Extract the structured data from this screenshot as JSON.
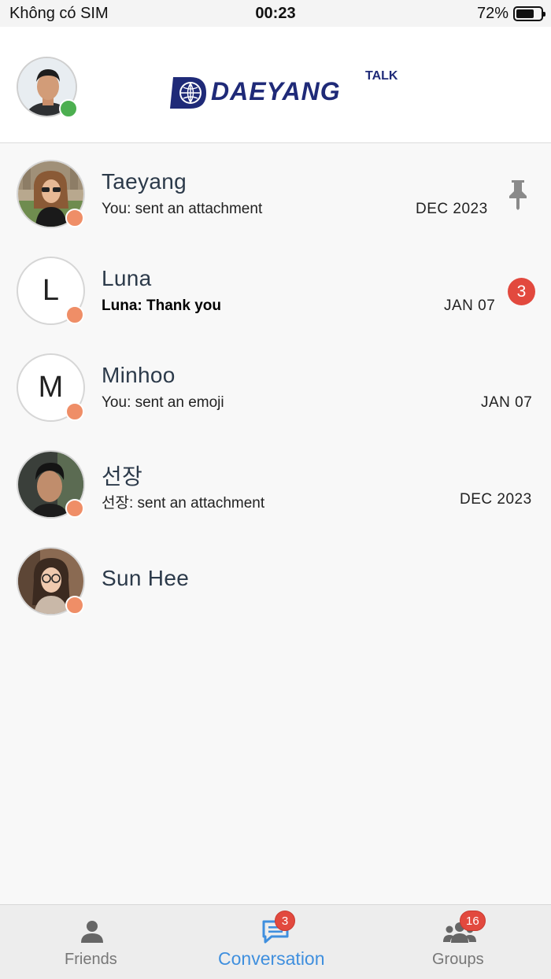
{
  "status_bar": {
    "carrier": "Không có SIM",
    "time": "00:23",
    "battery": "72%",
    "battery_level": 0.72
  },
  "header": {
    "logo_text": "DAEYANG",
    "logo_suffix": "TALK",
    "me_status_color": "#4caf50"
  },
  "conversations": [
    {
      "name": "Taeyang",
      "preview": "You: sent an attachment",
      "date": "DEC 2023",
      "pinned": true,
      "avatar": "photo"
    },
    {
      "name": "Luna",
      "preview": "Luna: Thank you",
      "date": "JAN 07",
      "unread": "3",
      "avatar_letter": "L",
      "bold": true
    },
    {
      "name": "Minhoo",
      "preview": "You: sent an emoji",
      "date": "JAN 07",
      "avatar_letter": "M"
    },
    {
      "name": "선장",
      "preview": "선장: sent an attachment",
      "date": "DEC 2023",
      "avatar": "photo"
    },
    {
      "name": "Sun Hee",
      "preview": "",
      "date": "",
      "avatar": "photo"
    }
  ],
  "tabs": {
    "friends": {
      "label": "Friends",
      "icon": "person-icon"
    },
    "conversation": {
      "label": "Conversation",
      "icon": "chat-icon",
      "badge": "3"
    },
    "groups": {
      "label": "Groups",
      "icon": "group-icon",
      "badge": "16"
    }
  },
  "colors": {
    "accent": "#3f8fde",
    "badge": "#e2493e",
    "presence_away": "#ef8e67",
    "brand": "#1f2a78"
  }
}
